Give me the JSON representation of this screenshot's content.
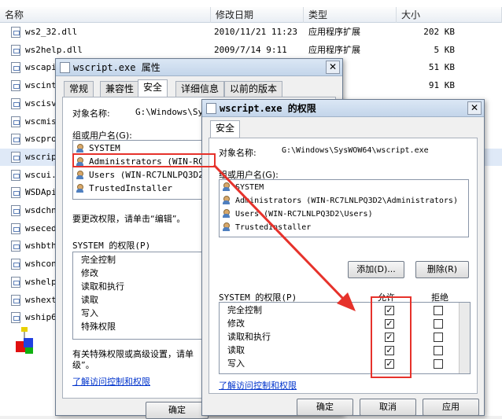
{
  "explorer": {
    "columns": [
      "名称",
      "修改日期",
      "类型",
      "大小"
    ],
    "files": [
      {
        "name": "ws2_32.dll",
        "date": "2010/11/21 11:23",
        "type": "应用程序扩展",
        "size": "202 KB"
      },
      {
        "name": "ws2help.dll",
        "date": "2009/7/14 9:11",
        "type": "应用程序扩展",
        "size": "5 KB"
      },
      {
        "name": "wscapi",
        "date": "",
        "type": "序扩展",
        "size": "51 KB"
      },
      {
        "name": "wscint",
        "date": "",
        "type": "序扩展",
        "size": "91 KB"
      },
      {
        "name": "wscisv",
        "date": "",
        "type": "",
        "size": ""
      },
      {
        "name": "wscmis",
        "date": "",
        "type": "",
        "size": ""
      },
      {
        "name": "wscpro",
        "date": "",
        "type": "",
        "size": ""
      },
      {
        "name": "wscript",
        "date": "",
        "type": "",
        "size": ""
      },
      {
        "name": "wscui.",
        "date": "",
        "type": "",
        "size": ""
      },
      {
        "name": "WSDApi",
        "date": "",
        "type": "",
        "size": ""
      },
      {
        "name": "wsdchn",
        "date": "",
        "type": "",
        "size": ""
      },
      {
        "name": "wsecedi",
        "date": "",
        "type": "",
        "size": ""
      },
      {
        "name": "wshbth",
        "date": "",
        "type": "",
        "size": ""
      },
      {
        "name": "wshcon",
        "date": "",
        "type": "",
        "size": ""
      },
      {
        "name": "wshelp",
        "date": "",
        "type": "",
        "size": ""
      },
      {
        "name": "wshext",
        "date": "",
        "type": "",
        "size": ""
      },
      {
        "name": "wship6",
        "date": "",
        "type": "",
        "size": ""
      }
    ]
  },
  "props": {
    "title": "wscript.exe 属性",
    "close": "✕",
    "tabs": [
      "常规",
      "兼容性",
      "安全",
      "详细信息",
      "以前的版本"
    ],
    "object_label": "对象名称:",
    "object_value": "G:\\Windows\\Sys",
    "group_label": "组或用户名(G):",
    "users": [
      "SYSTEM",
      "Administrators (WIN-RC7",
      "Users (WIN-RC7LNLPQ3D2\\",
      "TrustedInstaller"
    ],
    "edit_hint": "要更改权限，请单击“编辑”。",
    "perm_label": "SYSTEM 的权限(P)",
    "perms": [
      "完全控制",
      "修改",
      "读取和执行",
      "读取",
      "写入",
      "特殊权限"
    ],
    "advanced_hint": "有关特殊权限或高级设置，请单",
    "advanced_hint2": "级”。",
    "link": "了解访问控制和权限",
    "ok": "确定"
  },
  "perm_dialog": {
    "title": "wscript.exe 的权限",
    "close": "✕",
    "tab": "安全",
    "object_label": "对象名称:",
    "object_value": "G:\\Windows\\SysWOW64\\wscript.exe",
    "group_label": "组或用户名(G):",
    "users": [
      "SYSTEM",
      "Administrators (WIN-RC7LNLPQ3D2\\Administrators)",
      "Users (WIN-RC7LNLPQ3D2\\Users)",
      "TrustedInstaller"
    ],
    "add": "添加(D)...",
    "remove": "删除(R)",
    "perm_label": "SYSTEM 的权限(P)",
    "allow": "允许",
    "deny": "拒绝",
    "perms": [
      {
        "name": "完全控制",
        "allow": true,
        "deny": false
      },
      {
        "name": "修改",
        "allow": true,
        "deny": false
      },
      {
        "name": "读取和执行",
        "allow": true,
        "deny": false
      },
      {
        "name": "读取",
        "allow": true,
        "deny": false
      },
      {
        "name": "写入",
        "allow": true,
        "deny": false
      }
    ],
    "link": "了解访问控制和权限",
    "ok": "确定",
    "cancel": "取消",
    "apply": "应用"
  },
  "colors": {
    "highlight": "#e6322b",
    "link": "#0033cc"
  }
}
